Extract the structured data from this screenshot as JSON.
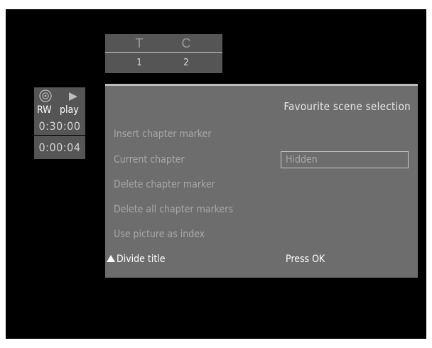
{
  "title_chapter": {
    "title_header": "T",
    "chapter_header": "C",
    "title_value": "1",
    "chapter_value": "2"
  },
  "status": {
    "disc_icon": "disc-icon",
    "play_icon": "play-icon",
    "media_label": "RW",
    "mode_label": "play",
    "total_time": "0:30:00",
    "elapsed_time": "0:00:04"
  },
  "menu": {
    "title": "Favourite scene selection",
    "items": [
      {
        "label": "Insert chapter marker"
      },
      {
        "label": "Current chapter",
        "value": "Hidden"
      },
      {
        "label": "Delete chapter marker"
      },
      {
        "label": "Delete all chapter markers"
      },
      {
        "label": "Use picture as index"
      },
      {
        "label": "Divide title",
        "action": "Press OK"
      }
    ]
  },
  "colors": {
    "background": "#000000",
    "panel": "#555555",
    "menu_panel": "#6d6d6d",
    "dim_text": "#a8a8a8",
    "highlight_text": "#ffffff"
  }
}
